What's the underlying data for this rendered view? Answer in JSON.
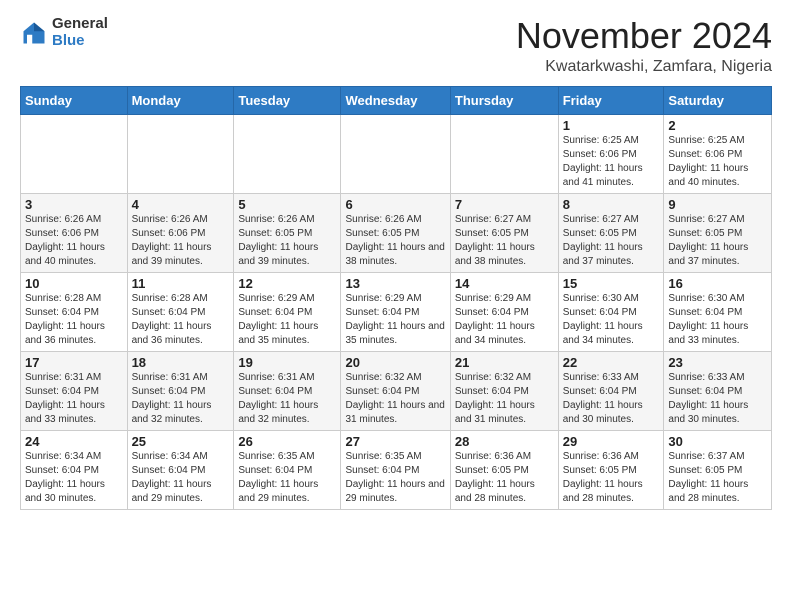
{
  "logo": {
    "general": "General",
    "blue": "Blue"
  },
  "title": "November 2024",
  "location": "Kwatarkwashi, Zamfara, Nigeria",
  "days_of_week": [
    "Sunday",
    "Monday",
    "Tuesday",
    "Wednesday",
    "Thursday",
    "Friday",
    "Saturday"
  ],
  "weeks": [
    [
      {
        "day": "",
        "info": ""
      },
      {
        "day": "",
        "info": ""
      },
      {
        "day": "",
        "info": ""
      },
      {
        "day": "",
        "info": ""
      },
      {
        "day": "",
        "info": ""
      },
      {
        "day": "1",
        "info": "Sunrise: 6:25 AM\nSunset: 6:06 PM\nDaylight: 11 hours and 41 minutes."
      },
      {
        "day": "2",
        "info": "Sunrise: 6:25 AM\nSunset: 6:06 PM\nDaylight: 11 hours and 40 minutes."
      }
    ],
    [
      {
        "day": "3",
        "info": "Sunrise: 6:26 AM\nSunset: 6:06 PM\nDaylight: 11 hours and 40 minutes."
      },
      {
        "day": "4",
        "info": "Sunrise: 6:26 AM\nSunset: 6:06 PM\nDaylight: 11 hours and 39 minutes."
      },
      {
        "day": "5",
        "info": "Sunrise: 6:26 AM\nSunset: 6:05 PM\nDaylight: 11 hours and 39 minutes."
      },
      {
        "day": "6",
        "info": "Sunrise: 6:26 AM\nSunset: 6:05 PM\nDaylight: 11 hours and 38 minutes."
      },
      {
        "day": "7",
        "info": "Sunrise: 6:27 AM\nSunset: 6:05 PM\nDaylight: 11 hours and 38 minutes."
      },
      {
        "day": "8",
        "info": "Sunrise: 6:27 AM\nSunset: 6:05 PM\nDaylight: 11 hours and 37 minutes."
      },
      {
        "day": "9",
        "info": "Sunrise: 6:27 AM\nSunset: 6:05 PM\nDaylight: 11 hours and 37 minutes."
      }
    ],
    [
      {
        "day": "10",
        "info": "Sunrise: 6:28 AM\nSunset: 6:04 PM\nDaylight: 11 hours and 36 minutes."
      },
      {
        "day": "11",
        "info": "Sunrise: 6:28 AM\nSunset: 6:04 PM\nDaylight: 11 hours and 36 minutes."
      },
      {
        "day": "12",
        "info": "Sunrise: 6:29 AM\nSunset: 6:04 PM\nDaylight: 11 hours and 35 minutes."
      },
      {
        "day": "13",
        "info": "Sunrise: 6:29 AM\nSunset: 6:04 PM\nDaylight: 11 hours and 35 minutes."
      },
      {
        "day": "14",
        "info": "Sunrise: 6:29 AM\nSunset: 6:04 PM\nDaylight: 11 hours and 34 minutes."
      },
      {
        "day": "15",
        "info": "Sunrise: 6:30 AM\nSunset: 6:04 PM\nDaylight: 11 hours and 34 minutes."
      },
      {
        "day": "16",
        "info": "Sunrise: 6:30 AM\nSunset: 6:04 PM\nDaylight: 11 hours and 33 minutes."
      }
    ],
    [
      {
        "day": "17",
        "info": "Sunrise: 6:31 AM\nSunset: 6:04 PM\nDaylight: 11 hours and 33 minutes."
      },
      {
        "day": "18",
        "info": "Sunrise: 6:31 AM\nSunset: 6:04 PM\nDaylight: 11 hours and 32 minutes."
      },
      {
        "day": "19",
        "info": "Sunrise: 6:31 AM\nSunset: 6:04 PM\nDaylight: 11 hours and 32 minutes."
      },
      {
        "day": "20",
        "info": "Sunrise: 6:32 AM\nSunset: 6:04 PM\nDaylight: 11 hours and 31 minutes."
      },
      {
        "day": "21",
        "info": "Sunrise: 6:32 AM\nSunset: 6:04 PM\nDaylight: 11 hours and 31 minutes."
      },
      {
        "day": "22",
        "info": "Sunrise: 6:33 AM\nSunset: 6:04 PM\nDaylight: 11 hours and 30 minutes."
      },
      {
        "day": "23",
        "info": "Sunrise: 6:33 AM\nSunset: 6:04 PM\nDaylight: 11 hours and 30 minutes."
      }
    ],
    [
      {
        "day": "24",
        "info": "Sunrise: 6:34 AM\nSunset: 6:04 PM\nDaylight: 11 hours and 30 minutes."
      },
      {
        "day": "25",
        "info": "Sunrise: 6:34 AM\nSunset: 6:04 PM\nDaylight: 11 hours and 29 minutes."
      },
      {
        "day": "26",
        "info": "Sunrise: 6:35 AM\nSunset: 6:04 PM\nDaylight: 11 hours and 29 minutes."
      },
      {
        "day": "27",
        "info": "Sunrise: 6:35 AM\nSunset: 6:04 PM\nDaylight: 11 hours and 29 minutes."
      },
      {
        "day": "28",
        "info": "Sunrise: 6:36 AM\nSunset: 6:05 PM\nDaylight: 11 hours and 28 minutes."
      },
      {
        "day": "29",
        "info": "Sunrise: 6:36 AM\nSunset: 6:05 PM\nDaylight: 11 hours and 28 minutes."
      },
      {
        "day": "30",
        "info": "Sunrise: 6:37 AM\nSunset: 6:05 PM\nDaylight: 11 hours and 28 minutes."
      }
    ]
  ]
}
